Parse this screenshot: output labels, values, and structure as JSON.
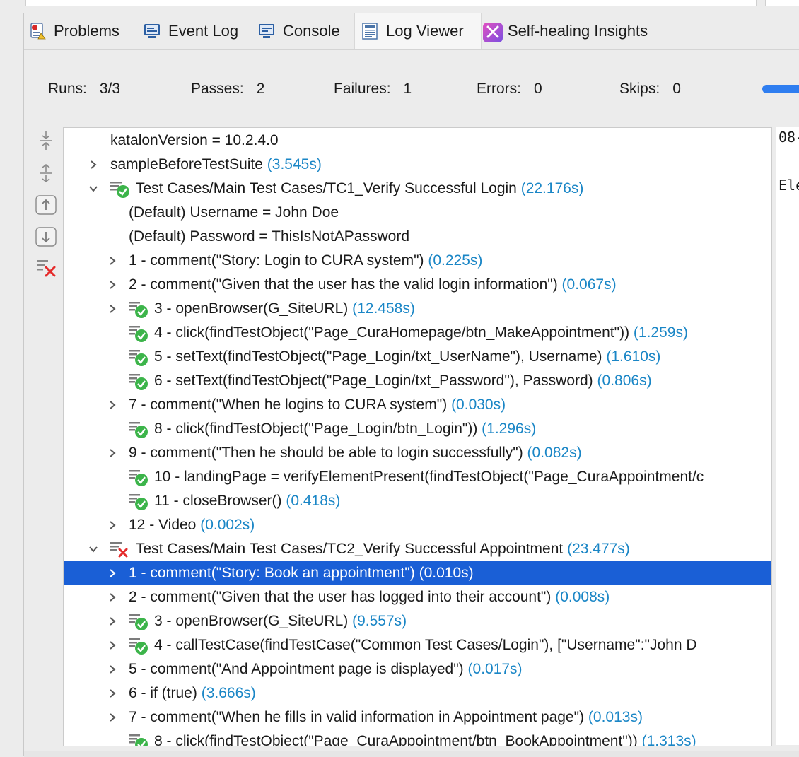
{
  "tabs": [
    {
      "label": "Problems",
      "icon": "problems-icon"
    },
    {
      "label": "Event Log",
      "icon": "event-log-icon"
    },
    {
      "label": "Console",
      "icon": "console-icon"
    },
    {
      "label": "Log Viewer",
      "icon": "log-viewer-icon",
      "active": true
    },
    {
      "label": "Self-healing Insights",
      "icon": "self-healing-icon"
    }
  ],
  "stats": {
    "runs_label": "Runs:",
    "runs_value": "3/3",
    "passes_label": "Passes:",
    "passes_value": "2",
    "failures_label": "Failures:",
    "failures_value": "1",
    "errors_label": "Errors:",
    "errors_value": "0",
    "skips_label": "Skips:",
    "skips_value": "0"
  },
  "side_tools": [
    "collapse-all-icon",
    "expand-all-icon",
    "previous-icon",
    "next-icon",
    "clear-failures-icon"
  ],
  "tree": {
    "rows": [
      {
        "text": "katalonVersion = 10.2.4.0",
        "dur": "",
        "expander": "none",
        "icon": "none"
      },
      {
        "text": "sampleBeforeTestSuite",
        "dur": "(3.545s)",
        "expander": "collapsed",
        "icon": "none"
      },
      {
        "text": "Test Cases/Main Test Cases/TC1_Verify Successful Login",
        "dur": "(22.176s)",
        "expander": "expanded",
        "icon": "pass"
      },
      {
        "text": "(Default) Username = John Doe",
        "dur": "",
        "expander": "none",
        "icon": "none"
      },
      {
        "text": "(Default) Password = ThisIsNotAPassword",
        "dur": "",
        "expander": "none",
        "icon": "none"
      },
      {
        "text": "1 - comment(\"Story: Login to CURA system\")",
        "dur": "(0.225s)",
        "expander": "collapsed",
        "icon": "none"
      },
      {
        "text": "2 - comment(\"Given that the user has the valid login information\")",
        "dur": "(0.067s)",
        "expander": "collapsed",
        "icon": "none"
      },
      {
        "text": "3 - openBrowser(G_SiteURL)",
        "dur": "(12.458s)",
        "expander": "collapsed",
        "icon": "pass"
      },
      {
        "text": "4 - click(findTestObject(\"Page_CuraHomepage/btn_MakeAppointment\"))",
        "dur": "(1.259s)",
        "expander": "none",
        "icon": "pass"
      },
      {
        "text": "5 - setText(findTestObject(\"Page_Login/txt_UserName\"), Username)",
        "dur": "(1.610s)",
        "expander": "none",
        "icon": "pass"
      },
      {
        "text": "6 - setText(findTestObject(\"Page_Login/txt_Password\"), Password)",
        "dur": "(0.806s)",
        "expander": "none",
        "icon": "pass"
      },
      {
        "text": "7 - comment(\"When he logins to CURA system\")",
        "dur": "(0.030s)",
        "expander": "collapsed",
        "icon": "none"
      },
      {
        "text": "8 - click(findTestObject(\"Page_Login/btn_Login\"))",
        "dur": "(1.296s)",
        "expander": "none",
        "icon": "pass"
      },
      {
        "text": "9 - comment(\"Then he should be able to login successfully\")",
        "dur": "(0.082s)",
        "expander": "collapsed",
        "icon": "none"
      },
      {
        "text": "10 - landingPage = verifyElementPresent(findTestObject(\"Page_CuraAppointment/c",
        "dur": "",
        "expander": "none",
        "icon": "pass"
      },
      {
        "text": "11 - closeBrowser()",
        "dur": "(0.418s)",
        "expander": "none",
        "icon": "pass"
      },
      {
        "text": "12 - Video",
        "dur": "(0.002s)",
        "expander": "collapsed",
        "icon": "none"
      },
      {
        "text": "Test Cases/Main Test Cases/TC2_Verify Successful Appointment",
        "dur": "(23.477s)",
        "expander": "expanded",
        "icon": "fail"
      },
      {
        "text": "1 - comment(\"Story: Book an appointment\")",
        "dur": "(0.010s)",
        "expander": "collapsed",
        "icon": "none",
        "selected": true
      },
      {
        "text": "2 - comment(\"Given that the user has logged into their account\")",
        "dur": "(0.008s)",
        "expander": "collapsed",
        "icon": "none"
      },
      {
        "text": "3 - openBrowser(G_SiteURL)",
        "dur": "(9.557s)",
        "expander": "collapsed",
        "icon": "pass"
      },
      {
        "text": "4 - callTestCase(findTestCase(\"Common Test Cases/Login\"), [\"Username\":\"John D",
        "dur": "",
        "expander": "collapsed",
        "icon": "pass"
      },
      {
        "text": "5 - comment(\"And Appointment page is displayed\")",
        "dur": "(0.017s)",
        "expander": "collapsed",
        "icon": "none"
      },
      {
        "text": "6 - if (true)",
        "dur": "(3.666s)",
        "expander": "collapsed",
        "icon": "none"
      },
      {
        "text": "7 - comment(\"When he fills in valid information in Appointment page\")",
        "dur": "(0.013s)",
        "expander": "collapsed",
        "icon": "none"
      },
      {
        "text": "8 - click(findTestObject(\"Page_CuraAppointment/btn_BookAppointment\"))",
        "dur": "(1.313s)",
        "expander": "none",
        "icon": "pass"
      }
    ]
  },
  "right_pane": {
    "line1": "08-",
    "line2": "Ele"
  },
  "colors": {
    "selection": "#1a5fd6",
    "duration": "#1a86c6",
    "pass": "#3cb44a",
    "fail": "#e52b2b",
    "progress": "#2f7ef0"
  }
}
